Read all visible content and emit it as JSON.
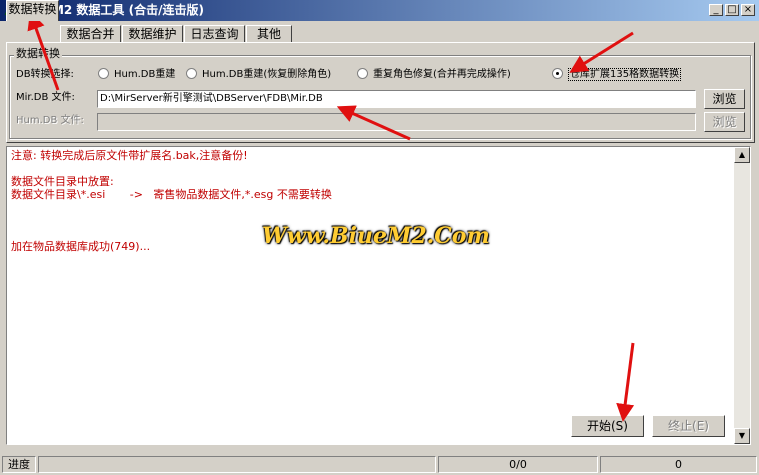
{
  "window": {
    "title": "BlueM2 数据工具 (合击/连击版)",
    "controls": {
      "minimize": "_",
      "maximize": "□",
      "close": "×"
    }
  },
  "tabs": [
    "数据转换",
    "数据合并",
    "数据维护",
    "日志查询",
    "其他"
  ],
  "group": {
    "title": "数据转换",
    "db_select_label": "DB转换选择:",
    "options": [
      {
        "label": "Hum.DB重建",
        "checked": false
      },
      {
        "label": "Hum.DB重建(恢复删除角色)",
        "checked": false
      },
      {
        "label": "重复角色修复(合并再完成操作)",
        "checked": false
      },
      {
        "label": "仓库扩展135格数据转换",
        "checked": true
      }
    ],
    "mir_db_label": "Mir.DB 文件:",
    "mir_db_value": "D:\\MirServer新引擎测试\\DBServer\\FDB\\Mir.DB",
    "hum_db_label": "Hum.DB 文件:",
    "hum_db_value": "",
    "browse_label": "浏览"
  },
  "log": {
    "lines": [
      "注意: 转换完成后原文件带扩展名.bak,注意备份!",
      "",
      "数据文件目录中放置:",
      "数据文件目录\\*.esi       ->   寄售物品数据文件,*.esg 不需要转换",
      "",
      "",
      "",
      "加在物品数据库成功(749)..."
    ],
    "color": "#c00000"
  },
  "watermark": "Www.BiueM2.Com",
  "buttons": {
    "start": "开始(S)",
    "stop": "终止(E)"
  },
  "status": {
    "label": "进度",
    "progress": "0/0",
    "count": "0"
  }
}
